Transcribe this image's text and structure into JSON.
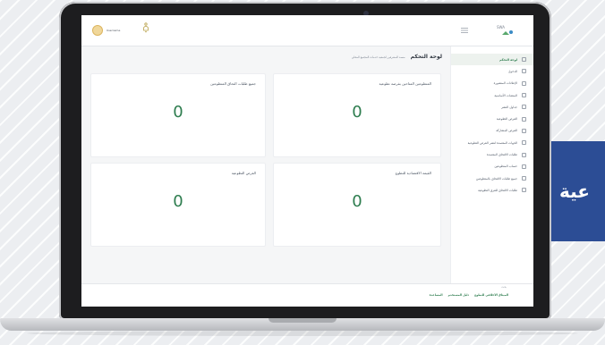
{
  "banner": {
    "text": "عية"
  },
  "header": {
    "user_name": "Username",
    "logo_text": "SWA"
  },
  "page": {
    "title": "لوحة التحكم",
    "subtitle": "منصة المشرفين لجمعية خدمات المجتمع المحلي"
  },
  "sidebar": {
    "items": [
      {
        "label": "لوحة التحكم",
        "active": true
      },
      {
        "label": "الدخول"
      },
      {
        "label": "الإعلانات المنشورة"
      },
      {
        "label": "المنصات الأساسية"
      },
      {
        "label": "جداول النشر"
      },
      {
        "label": "الفرص التطوعية"
      },
      {
        "label": "الفرص المشاركة"
      },
      {
        "label": "الجهات المعتمدة لنشر الفرص التطوعية"
      },
      {
        "label": "طلبات الالتحاق المعتمدة"
      },
      {
        "label": "حساب المتطوعين"
      },
      {
        "label": "جميع طلبات الالتحاق بالمتطوعين"
      },
      {
        "label": "طلبات الالتحاق للفرق التطوعية"
      }
    ]
  },
  "stats": [
    {
      "title": "المتطوعين المتاحين بفرصة تطوعية",
      "value": "0"
    },
    {
      "title": "جميع طلبات التحاق المتطوعين",
      "value": "0"
    },
    {
      "title": "القيمة الاقتصادية للتطوع",
      "value": "0"
    },
    {
      "title": "الفرص التطوعية",
      "value": "0"
    }
  ],
  "footer": {
    "search_label": "بحث",
    "links": [
      "الميثاق الأخلاقي للتطوع",
      "دليل المستخدم",
      "المساعدة"
    ]
  },
  "colors": {
    "accent": "#2e7d4f",
    "banner": "#2c4d95"
  }
}
